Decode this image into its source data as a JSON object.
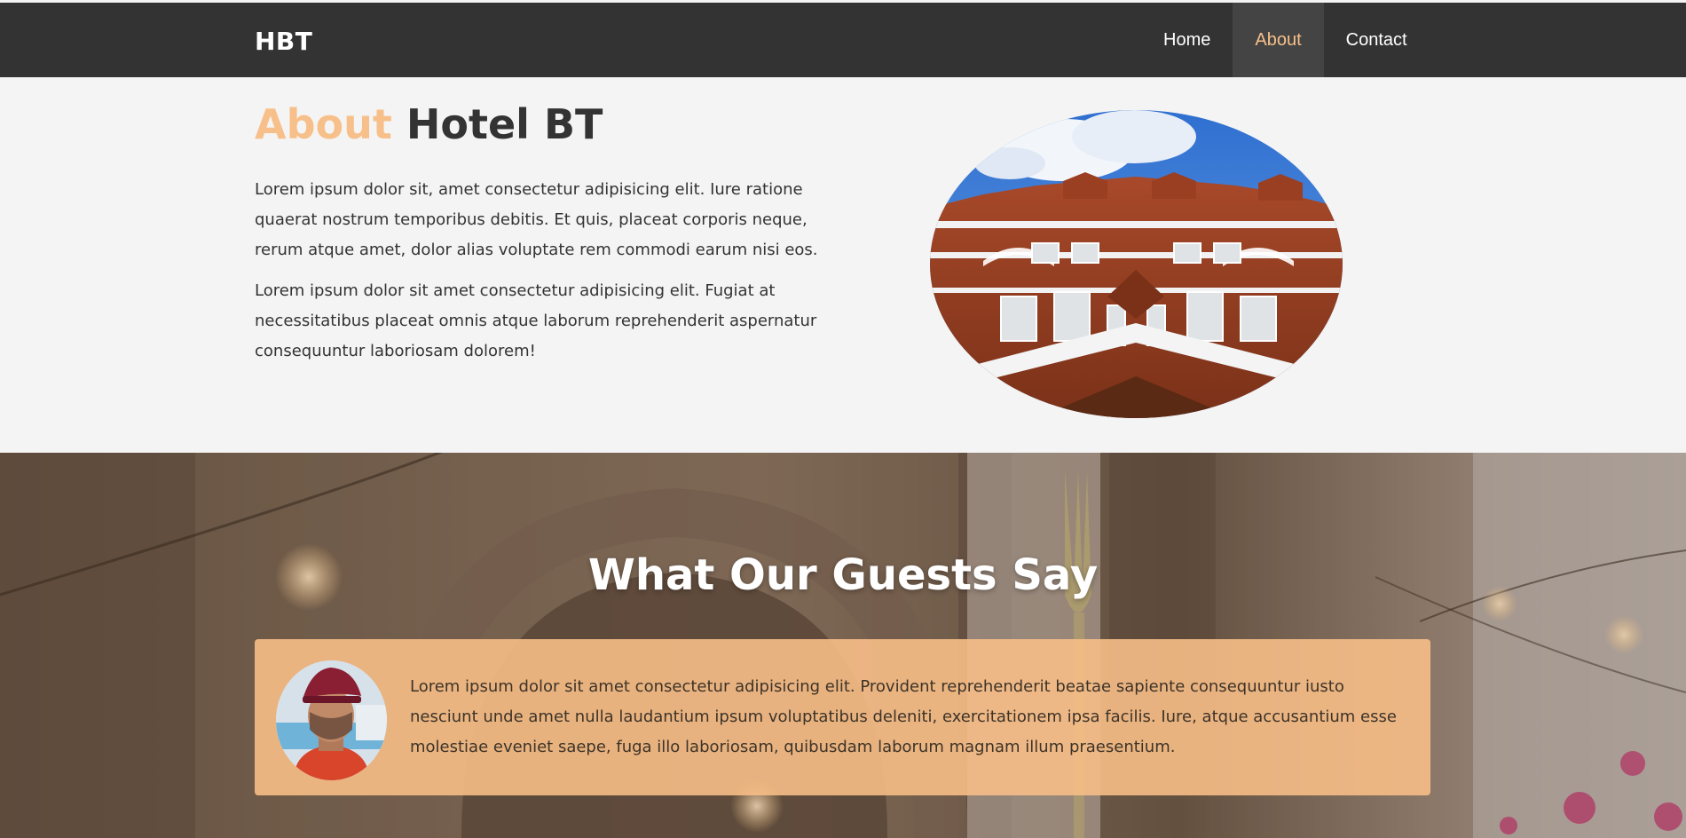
{
  "navbar": {
    "brand": "HBT",
    "items": [
      {
        "label": "Home",
        "active": false
      },
      {
        "label": "About",
        "active": true
      },
      {
        "label": "Contact",
        "active": false
      }
    ]
  },
  "about": {
    "title_accent": "About",
    "title_rest": " Hotel BT",
    "paragraphs": [
      "Lorem ipsum dolor sit, amet consectetur adipisicing elit. Iure ratione quaerat nostrum temporibus debitis. Et quis, placeat corporis neque, rerum atque amet, dolor alias voluptate rem commodi earum nisi eos.",
      "Lorem ipsum dolor sit amet consectetur adipisicing elit. Fugiat at necessitatibus placeat omnis atque laborum reprehenderit aspernatur consequuntur laboriosam dolorem!"
    ]
  },
  "testimonials": {
    "title": "What Our Guests Say",
    "items": [
      {
        "text": "Lorem ipsum dolor sit amet consectetur adipisicing elit. Provident reprehenderit beatae sapiente consequuntur iusto nesciunt unde amet nulla laudantium ipsum voluptatibus deleniti, exercitationem ipsa facilis. Iure, atque accusantium esse molestiae eveniet saepe, fuga illo laboriosam, quibusdam laborum magnam illum praesentium."
      }
    ]
  },
  "colors": {
    "nav_bg": "#333333",
    "accent": "#f7c08a",
    "card_bg": "#f7be87",
    "page_bg": "#f4f4f4"
  }
}
